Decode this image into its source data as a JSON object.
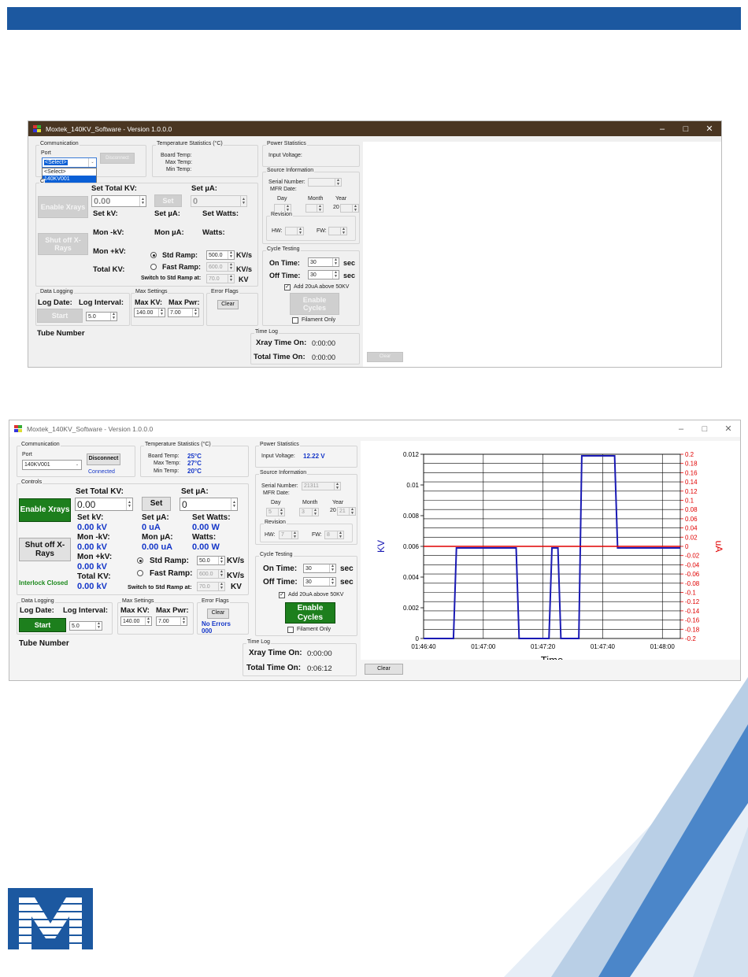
{
  "window": {
    "title": "Moxtek_140KV_Software - Version 1.0.0.0"
  },
  "s1": {
    "comm": {
      "group": "Communication",
      "port_label": "Port",
      "port_value": "<Select>",
      "disconnect": "Disconnect",
      "dropdown_items": [
        "<Select>",
        "140KV001"
      ]
    },
    "controls": {
      "group": "C"
    },
    "temp": {
      "group": "Temperature Statistics (°C)",
      "board": "Board Temp:",
      "max": "Max Temp:",
      "min": "Min Temp:"
    },
    "power": {
      "group": "Power Statistics",
      "input": "Input Voltage:"
    },
    "setkv": {
      "label": "Set Total KV:",
      "value": "0.00"
    },
    "setbtn": "Set",
    "setua": {
      "label": "Set µA:",
      "value": "0"
    },
    "enable_xrays": "Enable Xrays",
    "shut_off": "Shut off X-Rays",
    "lab_setkv": "Set kV:",
    "lab_setua": "Set µA:",
    "lab_setwatts": "Set Watts:",
    "lab_monkv": "Mon -kV:",
    "lab_monua": "Mon µA:",
    "lab_watts": "Watts:",
    "lab_monpkv": "Mon +kV:",
    "lab_totalkv": "Total KV:",
    "std_ramp": {
      "label": "Std Ramp:",
      "value": "500.0",
      "unit": "KV/s"
    },
    "fast_ramp": {
      "label": "Fast Ramp:",
      "value": "600.0",
      "unit": "KV/s"
    },
    "switch": {
      "label": "Switch to Std Ramp at:",
      "value": "70.0",
      "unit": "KV"
    },
    "source": {
      "group": "Source Information",
      "serial": "Serial Number:",
      "mfr": "MFR Date:",
      "day": "Day",
      "month": "Month",
      "year": "Year",
      "year_value": "20",
      "revision": "Revision",
      "hw": "HW:",
      "fw": "FW:"
    },
    "cycle": {
      "group": "Cycle Testing",
      "on_label": "On Time:",
      "on_value": "30",
      "off_label": "Off Time:",
      "off_value": "30",
      "sec": "sec",
      "add20": "Add 20uA above 50KV",
      "enable_cycles": "Enable Cycles",
      "filament": "Filament Only"
    },
    "datalog": {
      "group": "Data Logging",
      "log_date": "Log Date:",
      "log_interval": "Log Interval:",
      "start": "Start",
      "interval_value": "5.0"
    },
    "maxset": {
      "group": "Max Settings",
      "maxkv": "Max KV:",
      "maxpwr": "Max Pwr:",
      "kv_value": "140.00",
      "pwr_value": "7.00"
    },
    "errors": {
      "group": "Error Flags",
      "clear": "Clear"
    },
    "tube": "Tube Number",
    "timelog": {
      "group": "Time Log",
      "xray": "Xray Time On:",
      "xray_value": "0:00:00",
      "total": "Total Time On:",
      "total_value": "0:00:00"
    },
    "chart_clear": "Clear"
  },
  "s2": {
    "comm": {
      "group": "Communication",
      "port_label": "Port",
      "port_value": "140KV001",
      "disconnect": "Disconnect",
      "status": "Connected"
    },
    "controls": {
      "group": "Controls"
    },
    "temp": {
      "group": "Temperature Statistics (°C)",
      "board": "Board Temp:",
      "board_v": "25°C",
      "max": "Max Temp:",
      "max_v": "27°C",
      "min": "Min Temp:",
      "min_v": "20°C"
    },
    "power": {
      "group": "Power Statistics",
      "input": "Input Voltage:",
      "input_v": "12.22 V"
    },
    "setkv": {
      "label": "Set Total KV:",
      "value": "0.00"
    },
    "setbtn": "Set",
    "setua": {
      "label": "Set µA:",
      "value": "0"
    },
    "enable_xrays": "Enable Xrays",
    "shut_off": "Shut off X-Rays",
    "interlock": "Interlock Closed",
    "lab_setkv": "Set kV:",
    "v_setkv": "0.00 kV",
    "lab_setua": "Set µA:",
    "v_setua": "0 uA",
    "lab_setwatts": "Set Watts:",
    "v_setwatts": "0.00 W",
    "lab_monkv": "Mon -kV:",
    "v_monkv": "0.00 kV",
    "lab_monua": "Mon µA:",
    "v_monua": "0.00 uA",
    "lab_watts": "Watts:",
    "v_watts": "0.00 W",
    "lab_monpkv": "Mon +kV:",
    "v_monpkv": "0.00 kV",
    "lab_totalkv": "Total KV:",
    "v_totalkv": "0.00 kV",
    "std_ramp": {
      "label": "Std Ramp:",
      "value": "50.0",
      "unit": "KV/s"
    },
    "fast_ramp": {
      "label": "Fast Ramp:",
      "value": "600.0",
      "unit": "KV/s"
    },
    "switch": {
      "label": "Switch to Std Ramp at:",
      "value": "70.0",
      "unit": "KV"
    },
    "source": {
      "group": "Source Information",
      "serial": "Serial Number:",
      "serial_v": "21311",
      "mfr": "MFR Date:",
      "day": "Day",
      "day_v": "5",
      "month": "Month",
      "month_v": "3",
      "year": "Year",
      "year_pre": "20",
      "year_v": "21",
      "revision": "Revision",
      "hw": "HW:",
      "hw_v": "7",
      "fw": "FW:",
      "fw_v": "8"
    },
    "cycle": {
      "group": "Cycle Testing",
      "on_label": "On Time:",
      "on_value": "30",
      "off_label": "Off Time:",
      "off_value": "30",
      "sec": "sec",
      "add20": "Add 20uA above 50KV",
      "enable_cycles": "Enable Cycles",
      "filament": "Filament Only"
    },
    "datalog": {
      "group": "Data Logging",
      "log_date": "Log Date:",
      "log_interval": "Log Interval:",
      "start": "Start",
      "interval_value": "5.0"
    },
    "maxset": {
      "group": "Max Settings",
      "maxkv": "Max KV:",
      "maxpwr": "Max Pwr:",
      "kv_value": "140.00",
      "pwr_value": "7.00"
    },
    "errors": {
      "group": "Error Flags",
      "clear": "Clear",
      "none": "No Errors",
      "code": "000"
    },
    "tube": "Tube Number",
    "timelog": {
      "group": "Time Log",
      "xray": "Xray Time On:",
      "xray_value": "0:00:00",
      "total": "Total Time On:",
      "total_value": "0:06:12"
    },
    "chart_clear": "Clear"
  },
  "colors": {
    "header": "#1c58a0",
    "kv_line": "#1a1ab4",
    "ua_line": "#e00000",
    "green_btn": "#1d7f1d"
  },
  "chart_data": {
    "type": "line",
    "xlabel": "Time",
    "ylabel": "KV",
    "ylabel_right": "uA",
    "x_ticks": [
      "01:46:40",
      "01:47:00",
      "01:47:20",
      "01:47:40",
      "01:48:00"
    ],
    "x_tick_seconds": [
      40,
      60,
      80,
      100,
      120
    ],
    "xlim_seconds": [
      40,
      126
    ],
    "ylim": [
      0,
      0.012
    ],
    "y_ticks": [
      "0",
      "0.002",
      "0.004",
      "0.006",
      "0.008",
      "0.01",
      "0.012"
    ],
    "y_right_lim": [
      -0.2,
      0.2
    ],
    "y_right_ticks": [
      "0.2",
      "0.18",
      "0.16",
      "0.14",
      "0.12",
      "0.1",
      "0.08",
      "0.06",
      "0.04",
      "0.02",
      "0",
      "-0.02",
      "-0.04",
      "-0.06",
      "-0.08",
      "-0.1",
      "-0.12",
      "-0.14",
      "-0.16",
      "-0.18",
      "-0.2"
    ],
    "grid": true,
    "series": [
      {
        "axis": "left",
        "color": "#1a1ab4",
        "x": [
          40,
          50,
          51,
          71,
          72,
          82,
          83,
          85,
          86,
          87,
          88,
          92,
          93,
          104,
          105,
          126
        ],
        "y": [
          0,
          0,
          0.0059,
          0.0059,
          0,
          0,
          0.0059,
          0.0059,
          0,
          0,
          0,
          0,
          0.0119,
          0.0119,
          0.0059,
          0.0059
        ]
      },
      {
        "axis": "right",
        "color": "#e00000",
        "x": [
          40,
          126
        ],
        "y": [
          0,
          0
        ]
      }
    ]
  }
}
